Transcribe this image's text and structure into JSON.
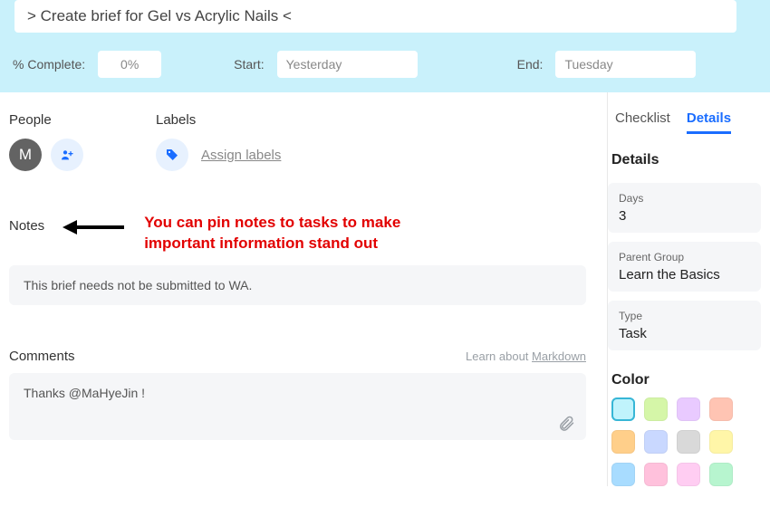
{
  "header": {
    "title_display": "> Create brief for Gel vs Acrylic Nails <",
    "pct_label": "% Complete:",
    "pct_value": "0%",
    "start_label": "Start:",
    "start_value": "Yesterday",
    "end_label": "End:",
    "end_value": "Tuesday"
  },
  "left": {
    "people_label": "People",
    "labels_label": "Labels",
    "avatar_initial": "M",
    "assign_labels": "Assign labels",
    "notes_label": "Notes",
    "annotation_text": "You can pin notes to tasks to make important information stand out",
    "note_body": "This brief needs not be submitted to WA.",
    "comments_label": "Comments",
    "markdown_prefix": "Learn about ",
    "markdown_link": "Markdown",
    "comment_text": "Thanks @MaHyeJin !"
  },
  "right": {
    "tabs": {
      "checklist": "Checklist",
      "details": "Details"
    },
    "details_title": "Details",
    "cards": {
      "days": {
        "label": "Days",
        "value": "3"
      },
      "parent": {
        "label": "Parent Group",
        "value": "Learn the Basics"
      },
      "type": {
        "label": "Type",
        "value": "Task"
      }
    },
    "color_title": "Color",
    "colors": {
      "r1c1": "#c0f3fc",
      "r1c2": "#d5f6a8",
      "r1c3": "#e9caff",
      "r1c4": "#ffc4b3",
      "r2c1": "#ffcf8a",
      "r2c2": "#c9d8ff",
      "r2c3": "#d9d9d9",
      "r2c4": "#fff6a8",
      "r3c1": "#a8dcff",
      "r3c2": "#ffc1dc",
      "r3c3": "#ffcdf2",
      "r3c4": "#b7f5cf"
    }
  }
}
